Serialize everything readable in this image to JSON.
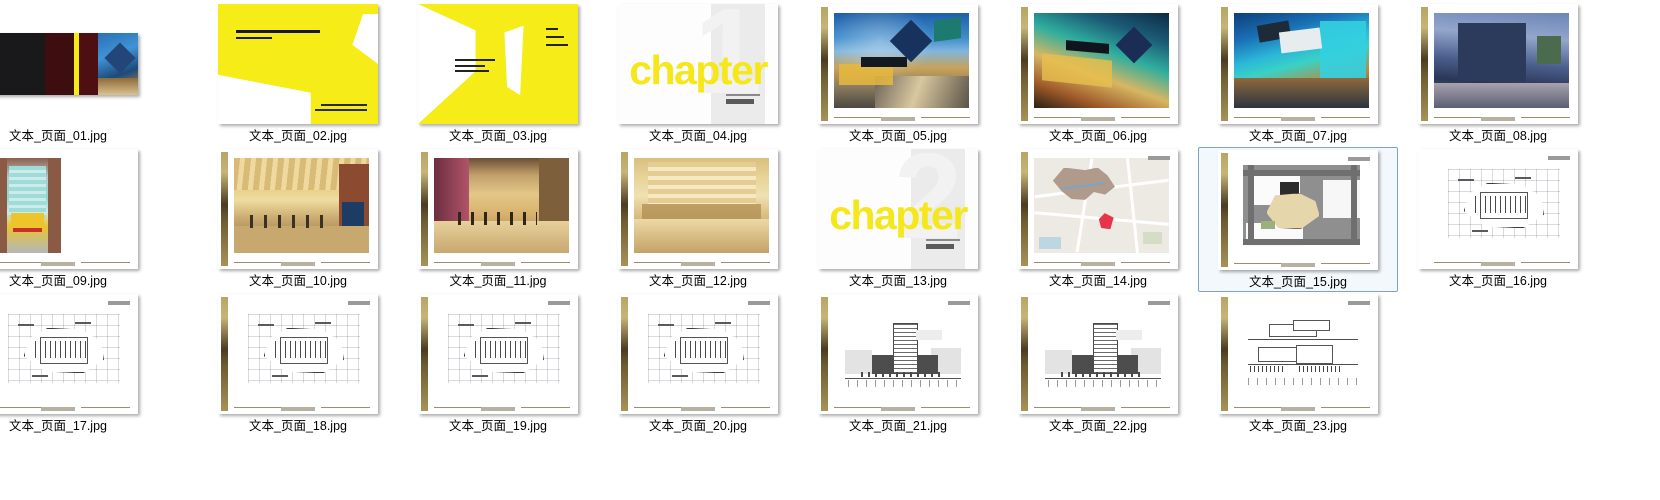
{
  "view": {
    "kind": "file-explorer-thumbnail-grid",
    "background_color": "#ffffff",
    "columns": 8,
    "rows": 3,
    "total_items": 23,
    "selected_index": 15,
    "selection_border_color": "#7da2ce",
    "selection_fill_color": "#f3f8fd"
  },
  "files": [
    {
      "name": "文本_页面_01.jpg",
      "kind": "cover-strip",
      "selected": false
    },
    {
      "name": "文本_页面_02.jpg",
      "kind": "yellow-cover",
      "selected": false
    },
    {
      "name": "文本_页面_03.jpg",
      "kind": "yellow-inner",
      "selected": false
    },
    {
      "name": "文本_页面_04.jpg",
      "kind": "chapter",
      "chapter_number": "1",
      "chapter_word": "chapter",
      "selected": false
    },
    {
      "name": "文本_页面_05.jpg",
      "kind": "photo-exterior",
      "selected": false
    },
    {
      "name": "文本_页面_06.jpg",
      "kind": "photo-exterior",
      "selected": false
    },
    {
      "name": "文本_页面_07.jpg",
      "kind": "photo-exterior",
      "selected": false
    },
    {
      "name": "文本_页面_08.jpg",
      "kind": "photo-exterior",
      "selected": false
    },
    {
      "name": "文本_页面_09.jpg",
      "kind": "photo-atrium",
      "selected": false
    },
    {
      "name": "文本_页面_10.jpg",
      "kind": "photo-interior",
      "selected": false
    },
    {
      "name": "文本_页面_11.jpg",
      "kind": "photo-interior",
      "selected": false
    },
    {
      "name": "文本_页面_12.jpg",
      "kind": "photo-interior",
      "selected": false
    },
    {
      "name": "文本_页面_13.jpg",
      "kind": "chapter",
      "chapter_number": "2",
      "chapter_word": "chapter",
      "selected": false
    },
    {
      "name": "文本_页面_14.jpg",
      "kind": "location-map",
      "selected": false
    },
    {
      "name": "文本_页面_15.jpg",
      "kind": "site-plan",
      "selected": true
    },
    {
      "name": "文本_页面_16.jpg",
      "kind": "floor-plan",
      "selected": false
    },
    {
      "name": "文本_页面_17.jpg",
      "kind": "floor-plan",
      "selected": false
    },
    {
      "name": "文本_页面_18.jpg",
      "kind": "floor-plan",
      "selected": false
    },
    {
      "name": "文本_页面_19.jpg",
      "kind": "floor-plan",
      "selected": false
    },
    {
      "name": "文本_页面_20.jpg",
      "kind": "floor-plan",
      "selected": false
    },
    {
      "name": "文本_页面_21.jpg",
      "kind": "elevation",
      "selected": false
    },
    {
      "name": "文本_页面_22.jpg",
      "kind": "elevation",
      "selected": false
    },
    {
      "name": "文本_页面_23.jpg",
      "kind": "section",
      "selected": false
    }
  ],
  "colors": {
    "brand_yellow": "#f5ec18",
    "chapter_grey": "#ebebeb",
    "label_text": "#000000",
    "page_white": "#ffffff",
    "spine_gold": "#b9a463"
  }
}
